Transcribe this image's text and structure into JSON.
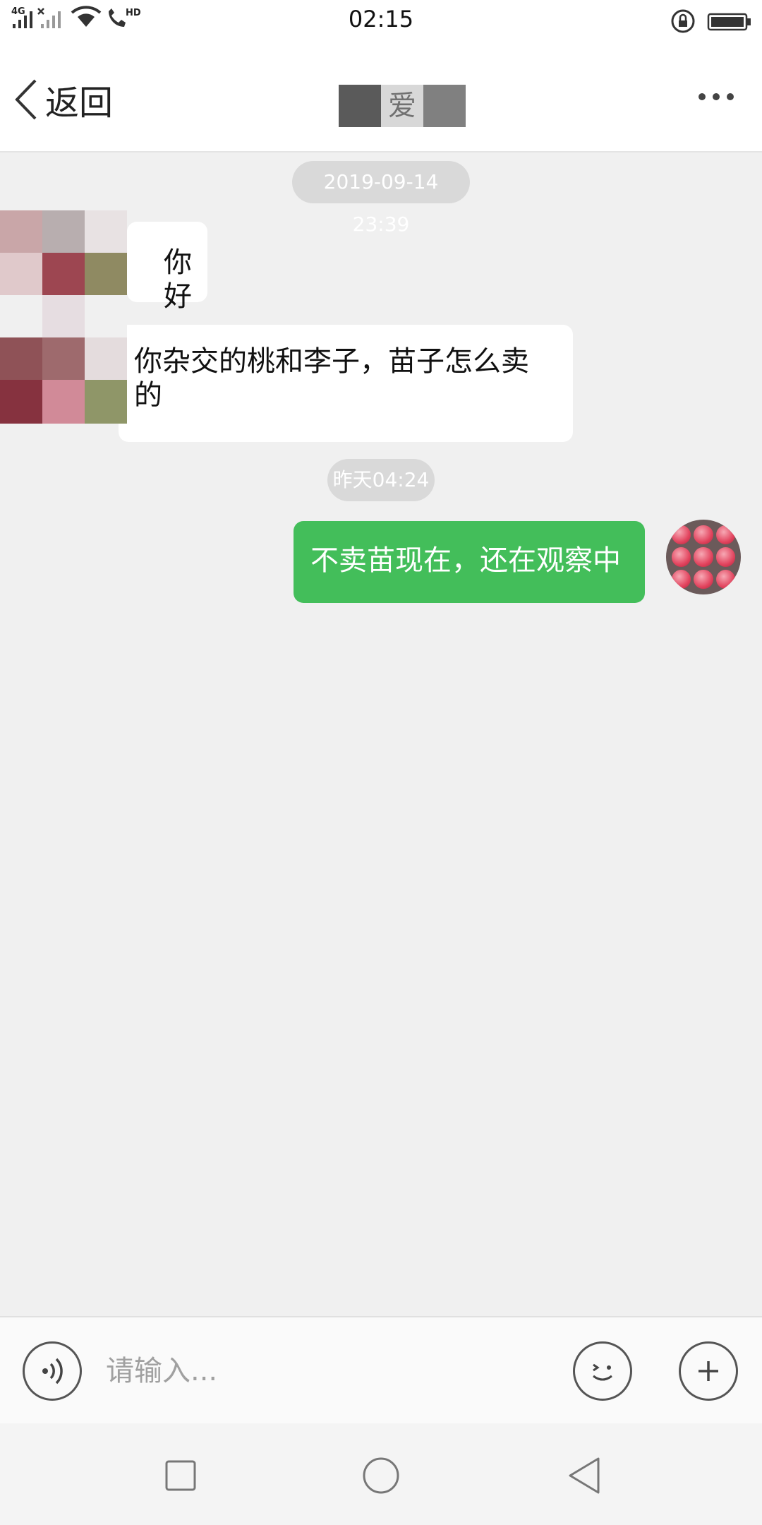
{
  "status_bar": {
    "network": "4G",
    "wifi_icon": "wifi-icon",
    "call_label": "HD",
    "time": "02:15"
  },
  "header": {
    "back_label": "返回",
    "contact_name": "爱"
  },
  "messages": [
    {
      "type": "timestamp",
      "text": "2019-09-14 23:39"
    },
    {
      "type": "incoming",
      "text": "你好"
    },
    {
      "type": "incoming",
      "text": "你杂交的桃和李子，苗子怎么卖的"
    },
    {
      "type": "timestamp",
      "text": "昨天04:24"
    },
    {
      "type": "outgoing",
      "text": "不卖苗现在，还在观察中"
    }
  ],
  "input": {
    "placeholder": "请输入..."
  },
  "colors": {
    "outgoing_bubble": "#43be5a",
    "background": "#f0f0f0"
  }
}
